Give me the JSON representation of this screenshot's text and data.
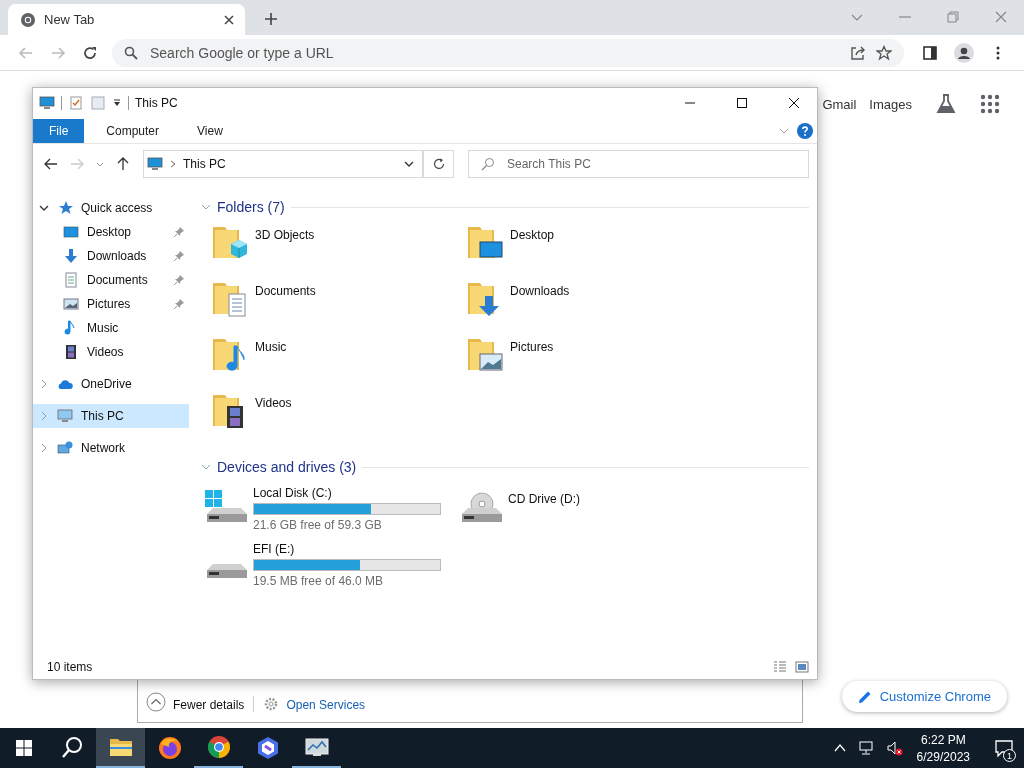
{
  "browser": {
    "tab": {
      "title": "New Tab"
    },
    "omnibox": {
      "placeholder": "Search Google or type a URL"
    },
    "links": [
      "Gmail",
      "Images"
    ],
    "customize_button": "Customize Chrome"
  },
  "task_manager": {
    "fewer_details": "Fewer details",
    "open_services": "Open Services"
  },
  "explorer": {
    "title": "This PC",
    "ribbon_tabs": [
      {
        "label": "File",
        "selected": true
      },
      {
        "label": "Computer",
        "selected": false
      },
      {
        "label": "View",
        "selected": false
      }
    ],
    "address": "This PC",
    "search": {
      "placeholder": "Search This PC"
    },
    "sidebar": {
      "items": [
        {
          "label": "Quick access",
          "kind": "star",
          "expanded": true,
          "selected": false,
          "children": [
            {
              "label": "Desktop",
              "kind": "desktop",
              "pinned": true,
              "selected": false
            },
            {
              "label": "Downloads",
              "kind": "downloads",
              "pinned": true,
              "selected": false
            },
            {
              "label": "Documents",
              "kind": "documents",
              "pinned": true,
              "selected": false
            },
            {
              "label": "Pictures",
              "kind": "pictures",
              "pinned": true,
              "selected": false
            },
            {
              "label": "Music",
              "kind": "music",
              "pinned": false,
              "selected": false
            },
            {
              "label": "Videos",
              "kind": "videos",
              "pinned": false,
              "selected": false
            }
          ]
        },
        {
          "label": "OneDrive",
          "kind": "cloud",
          "expanded": false,
          "selected": false
        },
        {
          "label": "This PC",
          "kind": "pc",
          "expanded": false,
          "selected": true
        },
        {
          "label": "Network",
          "kind": "network",
          "expanded": false,
          "selected": false
        }
      ]
    },
    "groups": [
      {
        "title": "Folders (7)",
        "kind": "folders",
        "items": [
          {
            "name": "3D Objects",
            "kind": "objects"
          },
          {
            "name": "Desktop",
            "kind": "desktop"
          },
          {
            "name": "Documents",
            "kind": "documents"
          },
          {
            "name": "Downloads",
            "kind": "downloads"
          },
          {
            "name": "Music",
            "kind": "music"
          },
          {
            "name": "Pictures",
            "kind": "pictures"
          },
          {
            "name": "Videos",
            "kind": "videos"
          }
        ]
      },
      {
        "title": "Devices and drives (3)",
        "kind": "drives",
        "items": [
          {
            "name": "Local Disk (C:)",
            "kind": "system",
            "level": 0.63,
            "free": "21.6 GB free of 59.3 GB"
          },
          {
            "name": "CD Drive (D:)",
            "kind": "optical"
          },
          {
            "name": "EFI (E:)",
            "kind": "disk",
            "level": 0.57,
            "free": "19.5 MB free of 46.0 MB"
          }
        ]
      }
    ],
    "status": "10 items"
  },
  "taskbar": {
    "apps": [
      {
        "kind": "explorer",
        "selected": true,
        "running": true
      },
      {
        "kind": "firefox",
        "selected": false,
        "running": false
      },
      {
        "kind": "chrome",
        "selected": false,
        "running": true
      },
      {
        "kind": "copilot",
        "selected": false,
        "running": false
      },
      {
        "kind": "monitor",
        "selected": false,
        "running": true
      }
    ],
    "time": "6:22 PM",
    "date": "6/29/2023",
    "notifications": "1"
  }
}
